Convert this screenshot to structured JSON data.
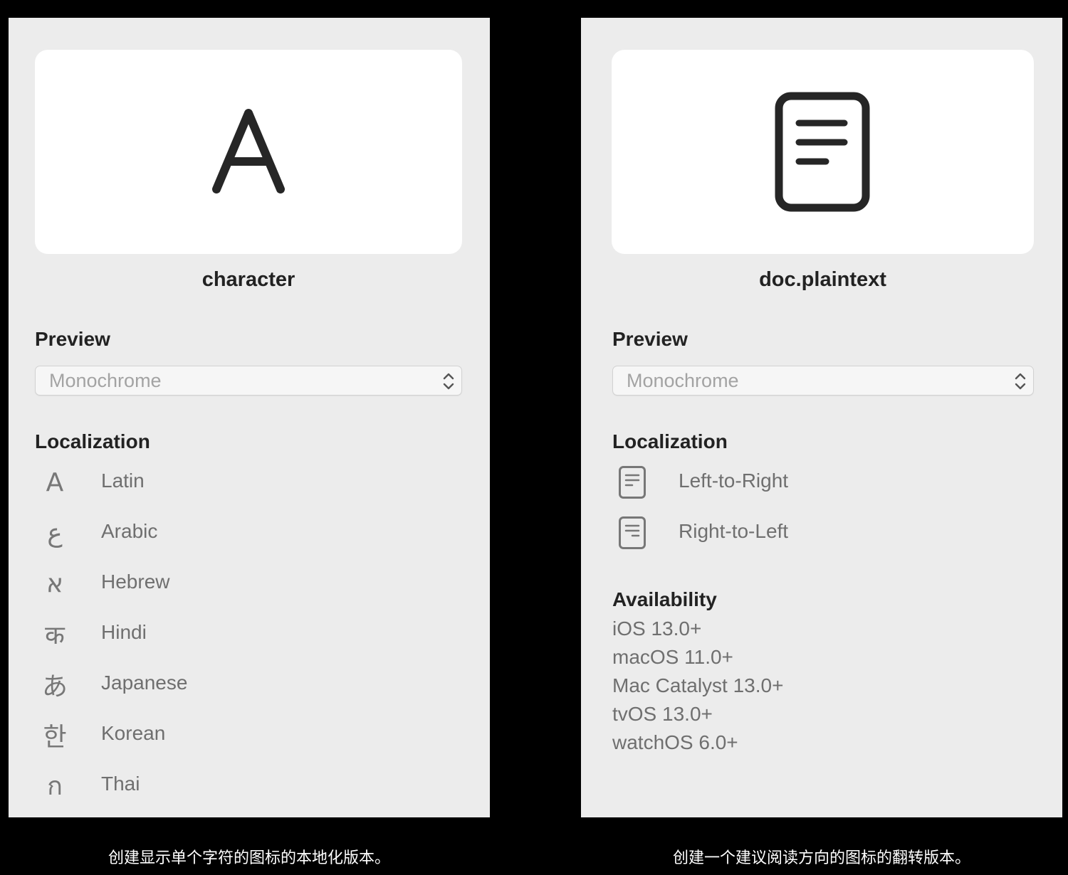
{
  "left_panel": {
    "symbol_name": "character",
    "preview_heading": "Preview",
    "preview_value": "Monochrome",
    "localization_heading": "Localization",
    "localizations": [
      {
        "glyph": "A",
        "icon": "latin-a-icon",
        "label": "Latin"
      },
      {
        "glyph": "ع",
        "icon": "arabic-ain-icon",
        "label": "Arabic"
      },
      {
        "glyph": "א",
        "icon": "hebrew-alef-icon",
        "label": "Hebrew"
      },
      {
        "glyph": "क",
        "icon": "hindi-ka-icon",
        "label": "Hindi"
      },
      {
        "glyph": "あ",
        "icon": "japanese-a-icon",
        "label": "Japanese"
      },
      {
        "glyph": "한",
        "icon": "korean-han-icon",
        "label": "Korean"
      },
      {
        "glyph": "ก",
        "icon": "thai-ko-icon",
        "label": "Thai"
      }
    ]
  },
  "right_panel": {
    "symbol_name": "doc.plaintext",
    "preview_heading": "Preview",
    "preview_value": "Monochrome",
    "localization_heading": "Localization",
    "localizations": [
      {
        "icon": "doc-plaintext-ltr-icon",
        "label": "Left-to-Right"
      },
      {
        "icon": "doc-plaintext-rtl-icon",
        "label": "Right-to-Left"
      }
    ],
    "availability_heading": "Availability",
    "availability": [
      "iOS 13.0+",
      "macOS 11.0+",
      "Mac Catalyst 13.0+",
      "tvOS 13.0+",
      "watchOS 6.0+"
    ]
  },
  "captions": {
    "left": "创建显示单个字符的图标的本地化版本。",
    "right": "创建一个建议阅读方向的图标的翻转版本。"
  },
  "colors": {
    "background": "#000000",
    "panel": "#ececec",
    "card": "#ffffff",
    "heading_text": "#222222",
    "secondary_text": "#6f6f6f",
    "popup_text": "#a3a3a3",
    "caption_text": "#ffffff"
  }
}
